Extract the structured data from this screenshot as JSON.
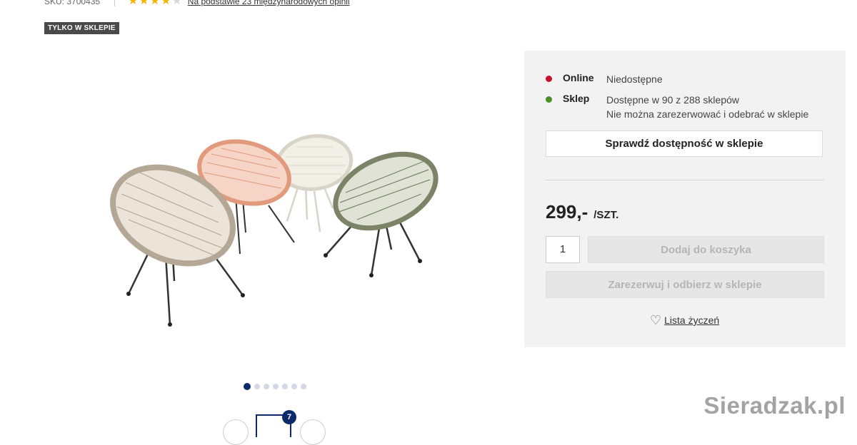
{
  "header": {
    "sku": "SKU: 3700435",
    "rating_stars": 4,
    "rating_max": 5,
    "reviews_link": "Na podstawie 23 międzynarodowych opinii",
    "badge": "TYLKO W SKLEPIE"
  },
  "gallery": {
    "image_icon": "chairs-product-photo",
    "dots_total": 7,
    "active_dot": 1,
    "thumbnail_count": "7"
  },
  "availability": {
    "online_label": "Online",
    "online_status": "Niedostępne",
    "online_color": "#c8102e",
    "store_label": "Sklep",
    "store_status": "Dostępne w 90 z 288 sklepów",
    "store_note": "Nie można zarezerwować i odebrać w sklepie",
    "store_color": "#4a8f2c"
  },
  "actions": {
    "check_store_button": "Sprawdź dostępność w sklepie",
    "price": "299,-",
    "price_unit": "/SZT.",
    "quantity": "1",
    "add_to_cart_button": "Dodaj do koszyka",
    "reserve_button": "Zarezerwuj i odbierz w sklepie",
    "wishlist_link": "Lista życzeń"
  },
  "watermark": "Sieradzak.pl"
}
